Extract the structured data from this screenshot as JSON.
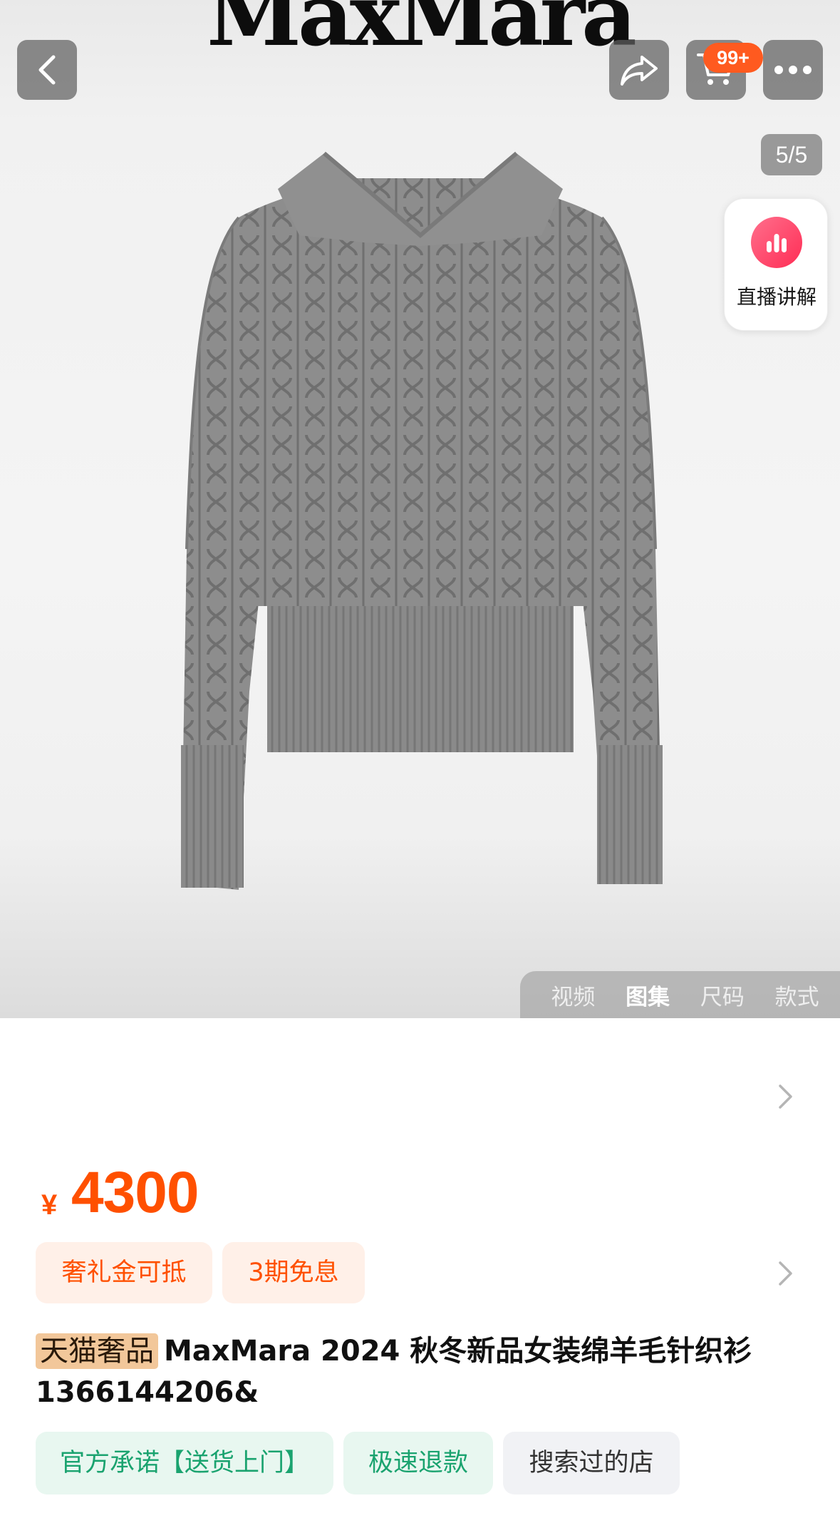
{
  "header": {
    "brand_logo_text": "MaxMara",
    "back_icon": "chevron-left-icon",
    "share_icon": "share-icon",
    "cart_icon": "cart-icon",
    "cart_badge": "99+",
    "more_icon": "more-dots-icon"
  },
  "gallery": {
    "counter": "5/5",
    "live_button_label": "直播讲解",
    "live_icon": "bar-chart-icon",
    "product_image": "grey-cable-knit-sweater",
    "tabs": [
      {
        "label": "视频",
        "active": false
      },
      {
        "label": "图集",
        "active": true
      },
      {
        "label": "尺码",
        "active": false
      },
      {
        "label": "款式",
        "active": false
      }
    ]
  },
  "price": {
    "currency": "¥",
    "value": "4300"
  },
  "promotions": [
    {
      "label": "奢礼金可抵"
    },
    {
      "label": "3期免息"
    }
  ],
  "product": {
    "tag": "天猫奢品",
    "title": "MaxMara 2024 秋冬新品女装绵羊毛针织衫 1366144206&"
  },
  "service_tags": [
    {
      "label": "官方承诺【送货上门】"
    },
    {
      "label": "极速退款"
    },
    {
      "label": "搜索过的店"
    }
  ],
  "colors": {
    "price_orange": "#ff5000",
    "badge_orange": "#ff5a1f",
    "service_green": "#1aa36f",
    "live_pink": "#ff2d55",
    "tag_gold": "#f2c79a"
  }
}
